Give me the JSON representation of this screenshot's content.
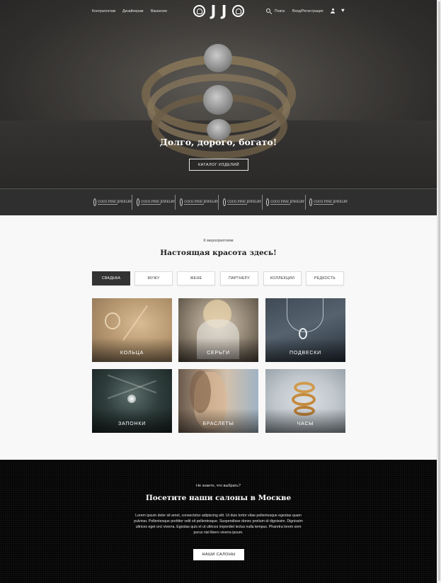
{
  "nav": {
    "links": [
      "Контрагентам",
      "Дизайнерам",
      "Вакансии"
    ],
    "logo_text": "OJJO",
    "search_label": "Поиск",
    "login_label": "Вход/Регистрация"
  },
  "hero": {
    "title": "Долго, дорого, богато!",
    "button": "КАТАЛОГ ИЗДЕЛИЙ"
  },
  "brands": [
    {
      "name": "COCO PINE JEWELRY"
    },
    {
      "name": "COCO PINE JEWELRY"
    },
    {
      "name": "COCO PINE JEWELRY"
    },
    {
      "name": "COCO PINE JEWELRY"
    },
    {
      "name": "COCO PINE JEWELRY"
    },
    {
      "name": "COCO PINE JEWELRY"
    }
  ],
  "events": {
    "eyebrow": "К мероприятиям",
    "title": "Настоящая красота здесь!",
    "tabs": [
      "СВАДЬБА",
      "МУЖУ",
      "ЖЕНЕ",
      "ПАРТНЕРУ",
      "КОЛЛЕКЦИИ",
      "РЕДКОСТЬ"
    ],
    "active_tab": "СВАДЬБА",
    "cards": [
      "КОЛЬЦА",
      "СЕРЬГИ",
      "ПОДВЕСКИ",
      "ЗАПОНКИ",
      "БРАСЛЕТЫ",
      "ЧАСЫ"
    ]
  },
  "salons": {
    "eyebrow": "Не знаете, что выбрать?",
    "title": "Посетите наши салоны в Москве",
    "text": "Lorem ipsum dolor sit amet, consectetur adipiscing elit. Ut duis tortor vitae pellentesque egestas quam pulvinar. Pellentesque porttitor velit sit pellentesque. Suspendisse donec pretium id dignissim. Dignissim ultrices eget orci viverra. Egestas quis et ut ultrices imperdiet lectus nulla tempus. Pharetra lorem sem purus nisl libero viverra ipsum.",
    "button": "НАШИ САЛОНЫ"
  },
  "colors": {
    "dark": "#333333",
    "footer_bg": "#050505",
    "section_bg": "#f8f8f8"
  },
  "icons": [
    "search-icon",
    "user-icon",
    "heart-icon"
  ]
}
